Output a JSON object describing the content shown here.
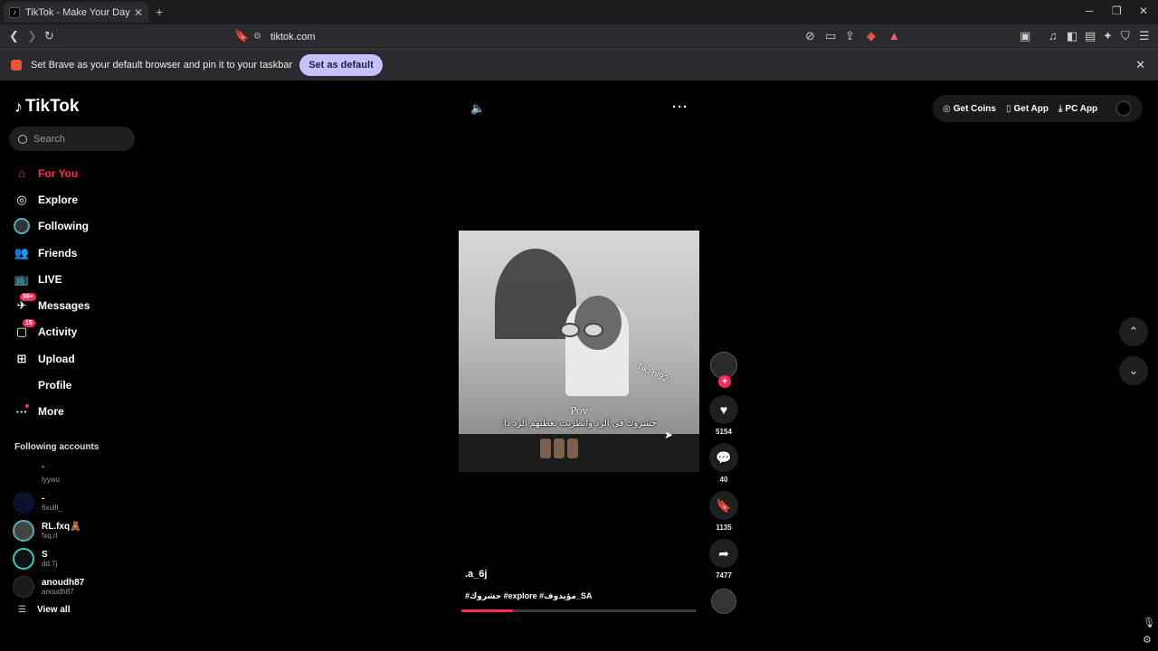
{
  "browser": {
    "tab_title": "TikTok - Make Your Day",
    "url": "tiktok.com",
    "infobar": {
      "message": "Set Brave as your default browser and pin it to your taskbar",
      "button": "Set as default"
    }
  },
  "tiktok": {
    "logo": "TikTok",
    "search_placeholder": "Search",
    "nav": [
      {
        "label": "For You",
        "icon": "home-icon",
        "active": true
      },
      {
        "label": "Explore",
        "icon": "compass-icon"
      },
      {
        "label": "Following",
        "icon": "following-avatar-icon"
      },
      {
        "label": "Friends",
        "icon": "friends-icon"
      },
      {
        "label": "LIVE",
        "icon": "live-tv-icon"
      },
      {
        "label": "Messages",
        "icon": "message-icon",
        "badge": "99+"
      },
      {
        "label": "Activity",
        "icon": "activity-icon",
        "badge": "15"
      },
      {
        "label": "Upload",
        "icon": "upload-plus-icon"
      },
      {
        "label": "Profile",
        "icon": ""
      },
      {
        "label": "More",
        "icon": "more-dots-icon",
        "dot": true
      }
    ],
    "following_title": "Following accounts",
    "following_accounts": [
      {
        "name": "`",
        "handle": "lyywu"
      },
      {
        "name": "-",
        "handle": "6xulll_"
      },
      {
        "name": "RL.fxq🧸",
        "handle": "fxq.rl"
      },
      {
        "name": "S",
        "handle": "dd.7j"
      },
      {
        "name": "anoudh87",
        "handle": "anoudh87"
      }
    ],
    "view_all": "View all",
    "top_actions": {
      "coins": "Get Coins",
      "app": "Get App",
      "pc": "PC App"
    },
    "video": {
      "overlay_line1": "Pov",
      "overlay_line2": "حشروك في الرد وانظريت تعطيهم الرد ذا:",
      "watermark": "Tik: nl92",
      "author": ".a_6j",
      "description": "#حشروك #explore #مؤيدوف_SA",
      "likes": "5154",
      "comments": "40",
      "saves": "1135",
      "shares": "7477",
      "progress": 0.22
    }
  }
}
